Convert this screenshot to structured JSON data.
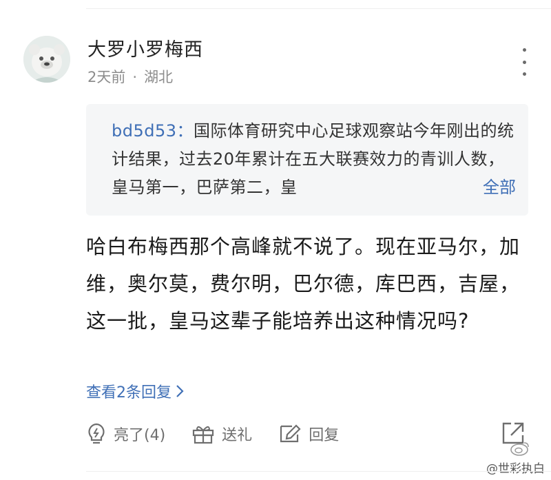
{
  "comment": {
    "username": "大罗小罗梅西",
    "time": "2天前",
    "separator": "·",
    "location": "湖北",
    "quote": {
      "author": "bd5d53：",
      "text": "国际体育研究中心足球观察站今年刚出的统计结果，过去20年累计在五大联赛效力的青训人数，皇马第一，巴萨第二，皇",
      "more_label": "全部"
    },
    "body": "哈白布梅西那个高峰就不说了。现在亚马尔，加维，奥尔莫，费尔明，巴尔德，库巴西，吉屋，这一批，皇马这辈子能培养出这种情况吗?",
    "view_replies_label": "查看2条回复"
  },
  "actions": {
    "like_label": "亮了(4)",
    "gift_label": "送礼",
    "reply_label": "回复"
  },
  "watermark": "@世彩执白",
  "colors": {
    "link": "#3f6fb6",
    "muted": "#8c8c8c",
    "quote_bg": "#f5f6f7"
  }
}
